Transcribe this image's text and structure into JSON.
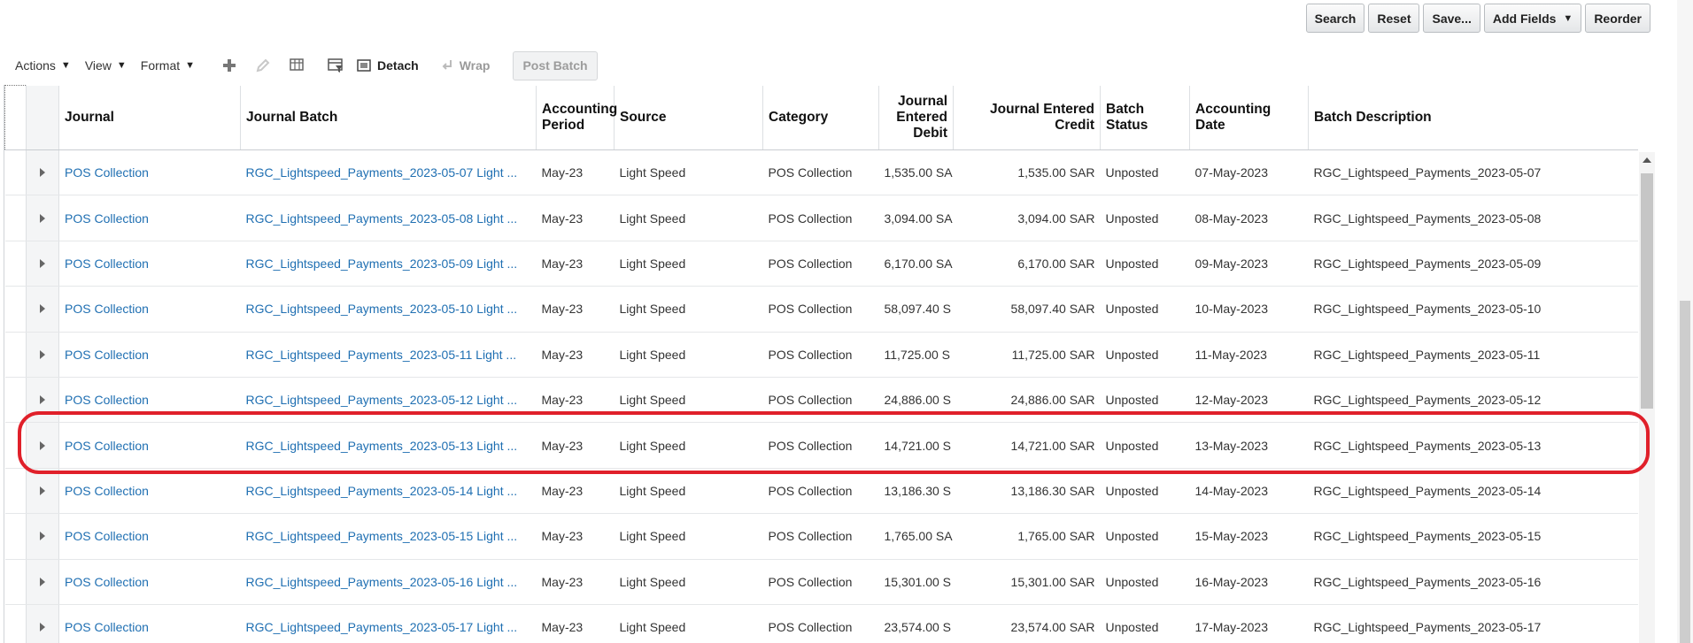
{
  "search_buttons": {
    "search": "Search",
    "reset": "Reset",
    "save": "Save...",
    "add_fields": "Add Fields",
    "reorder": "Reorder"
  },
  "toolbar": {
    "actions": "Actions",
    "view": "View",
    "format": "Format",
    "detach": "Detach",
    "wrap": "Wrap",
    "post_batch": "Post Batch"
  },
  "columns": {
    "journal": "Journal",
    "journal_batch": "Journal Batch",
    "accounting_period": "Accounting Period",
    "source": "Source",
    "category": "Category",
    "entered_debit": "Journal Entered Debit",
    "entered_credit": "Journal Entered Credit",
    "batch_status": "Batch Status",
    "accounting_date": "Accounting Date",
    "batch_description": "Batch Description"
  },
  "rows": [
    {
      "journal": "POS Collection",
      "batch": "RGC_Lightspeed_Payments_2023-05-07 Light ...",
      "period": "May-23",
      "source": "Light Speed",
      "category": "POS Collection",
      "debit": "1,535.00 SA",
      "credit": "1,535.00 SAR",
      "status": "Unposted",
      "date": "07-May-2023",
      "description": "RGC_Lightspeed_Payments_2023-05-07"
    },
    {
      "journal": "POS Collection",
      "batch": "RGC_Lightspeed_Payments_2023-05-08 Light ...",
      "period": "May-23",
      "source": "Light Speed",
      "category": "POS Collection",
      "debit": "3,094.00 SA",
      "credit": "3,094.00 SAR",
      "status": "Unposted",
      "date": "08-May-2023",
      "description": "RGC_Lightspeed_Payments_2023-05-08"
    },
    {
      "journal": "POS Collection",
      "batch": "RGC_Lightspeed_Payments_2023-05-09 Light ...",
      "period": "May-23",
      "source": "Light Speed",
      "category": "POS Collection",
      "debit": "6,170.00 SA",
      "credit": "6,170.00 SAR",
      "status": "Unposted",
      "date": "09-May-2023",
      "description": "RGC_Lightspeed_Payments_2023-05-09"
    },
    {
      "journal": "POS Collection",
      "batch": "RGC_Lightspeed_Payments_2023-05-10 Light ...",
      "period": "May-23",
      "source": "Light Speed",
      "category": "POS Collection",
      "debit": "58,097.40 S",
      "credit": "58,097.40 SAR",
      "status": "Unposted",
      "date": "10-May-2023",
      "description": "RGC_Lightspeed_Payments_2023-05-10"
    },
    {
      "journal": "POS Collection",
      "batch": "RGC_Lightspeed_Payments_2023-05-11 Light ...",
      "period": "May-23",
      "source": "Light Speed",
      "category": "POS Collection",
      "debit": "11,725.00 S",
      "credit": "11,725.00 SAR",
      "status": "Unposted",
      "date": "11-May-2023",
      "description": "RGC_Lightspeed_Payments_2023-05-11"
    },
    {
      "journal": "POS Collection",
      "batch": "RGC_Lightspeed_Payments_2023-05-12 Light ...",
      "period": "May-23",
      "source": "Light Speed",
      "category": "POS Collection",
      "debit": "24,886.00 S",
      "credit": "24,886.00 SAR",
      "status": "Unposted",
      "date": "12-May-2023",
      "description": "RGC_Lightspeed_Payments_2023-05-12"
    },
    {
      "journal": "POS Collection",
      "batch": "RGC_Lightspeed_Payments_2023-05-13 Light ...",
      "period": "May-23",
      "source": "Light Speed",
      "category": "POS Collection",
      "debit": "14,721.00 S",
      "credit": "14,721.00 SAR",
      "status": "Unposted",
      "date": "13-May-2023",
      "description": "RGC_Lightspeed_Payments_2023-05-13"
    },
    {
      "journal": "POS Collection",
      "batch": "RGC_Lightspeed_Payments_2023-05-14 Light ...",
      "period": "May-23",
      "source": "Light Speed",
      "category": "POS Collection",
      "debit": "13,186.30 S",
      "credit": "13,186.30 SAR",
      "status": "Unposted",
      "date": "14-May-2023",
      "description": "RGC_Lightspeed_Payments_2023-05-14"
    },
    {
      "journal": "POS Collection",
      "batch": "RGC_Lightspeed_Payments_2023-05-15 Light ...",
      "period": "May-23",
      "source": "Light Speed",
      "category": "POS Collection",
      "debit": "1,765.00 SA",
      "credit": "1,765.00 SAR",
      "status": "Unposted",
      "date": "15-May-2023",
      "description": "RGC_Lightspeed_Payments_2023-05-15"
    },
    {
      "journal": "POS Collection",
      "batch": "RGC_Lightspeed_Payments_2023-05-16 Light ...",
      "period": "May-23",
      "source": "Light Speed",
      "category": "POS Collection",
      "debit": "15,301.00 S",
      "credit": "15,301.00 SAR",
      "status": "Unposted",
      "date": "16-May-2023",
      "description": "RGC_Lightspeed_Payments_2023-05-16"
    },
    {
      "journal": "POS Collection",
      "batch": "RGC_Lightspeed_Payments_2023-05-17 Light ...",
      "period": "May-23",
      "source": "Light Speed",
      "category": "POS Collection",
      "debit": "23,574.00 S",
      "credit": "23,574.00 SAR",
      "status": "Unposted",
      "date": "17-May-2023",
      "description": "RGC_Lightspeed_Payments_2023-05-17"
    }
  ],
  "highlighted_row": 6,
  "colors": {
    "link": "#1f6fb2",
    "highlight": "#e0202a"
  }
}
